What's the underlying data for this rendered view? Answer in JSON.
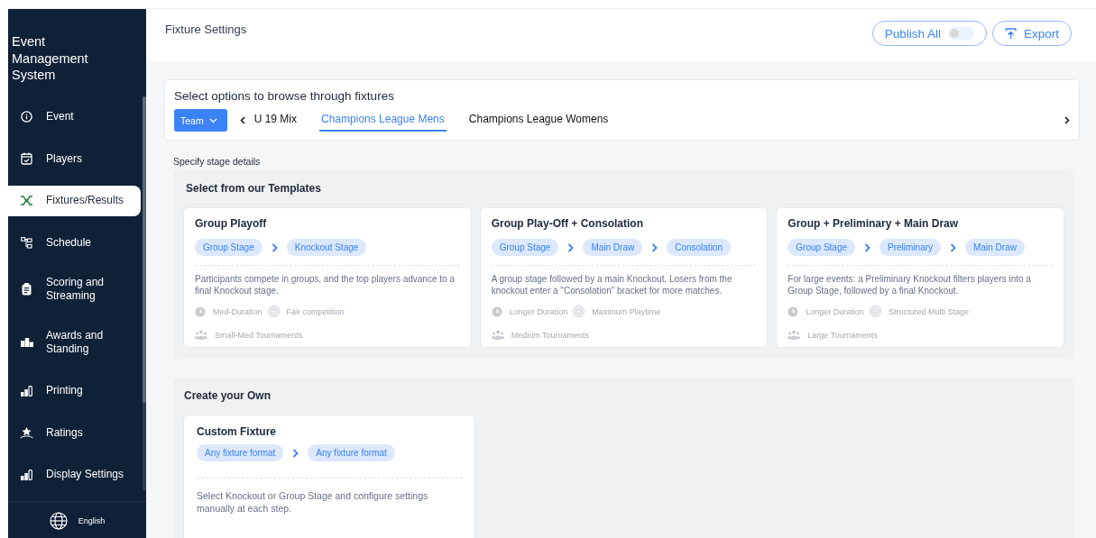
{
  "sidebar": {
    "title": "Event Management System",
    "items": [
      {
        "label": "Event",
        "selected": false
      },
      {
        "label": "Players",
        "selected": false
      },
      {
        "label": "Fixtures/Results",
        "selected": true
      },
      {
        "label": "Schedule",
        "selected": false
      },
      {
        "label": "Scoring and Streaming",
        "selected": false
      },
      {
        "label": "Awards and Standing",
        "selected": false
      },
      {
        "label": "Printing",
        "selected": false
      },
      {
        "label": "Ratings",
        "selected": false
      },
      {
        "label": "Display Settings",
        "selected": false
      }
    ],
    "language": "English"
  },
  "header": {
    "title": "Fixture Settings",
    "publish": {
      "label": "Publish All",
      "on": false
    },
    "export": "Export"
  },
  "browser": {
    "title": "Select options to browse through fixtures",
    "filter": "Team",
    "tabs": [
      {
        "label": "U 19 Mix",
        "selected": false
      },
      {
        "label": "Champions League Mens",
        "selected": true
      },
      {
        "label": "Champions League Womens",
        "selected": false
      }
    ]
  },
  "stage_label": "Specify stage details",
  "templates": {
    "title": "Select from our Templates",
    "cards": [
      {
        "title": "Group Playoff",
        "stages": [
          "Group Stage",
          "Knockout Stage"
        ],
        "description": "Participants compete in groups, and the top players advance to a final Knockout stage.",
        "features": [
          {
            "kind": "duration",
            "label": "Med-Duration"
          },
          {
            "kind": "target",
            "label": "Fair competition"
          },
          {
            "kind": "people",
            "label": "Small-Med Tournaments"
          }
        ]
      },
      {
        "title": "Group Play-Off + Consolation",
        "stages": [
          "Group Stage",
          "Main Draw",
          "Consolation"
        ],
        "description": "A group stage followed by a main Knockout. Losers from the knockout enter a \"Consolation\" bracket for more matches.",
        "features": [
          {
            "kind": "duration",
            "label": "Longer Duration"
          },
          {
            "kind": "target",
            "label": "Maximum Playtime"
          },
          {
            "kind": "people",
            "label": "Medium Tournaments"
          }
        ]
      },
      {
        "title": "Group + Preliminary + Main Draw",
        "stages": [
          "Group Stage",
          "Preliminary",
          "Main Draw"
        ],
        "description": "For large events: a Preliminary Knockout filters players into a Group Stage, followed by a final Knockout.",
        "features": [
          {
            "kind": "duration",
            "label": "Longer Duration"
          },
          {
            "kind": "target",
            "label": "Structured Multi Stage"
          },
          {
            "kind": "people",
            "label": "Large Tournaments"
          }
        ]
      }
    ]
  },
  "custom": {
    "title": "Create your Own",
    "cards": [
      {
        "title": "Custom Fixture",
        "stages": [
          "Any fixture format",
          "Any fixture format"
        ],
        "description": "Select Knockout or Group Stage and configure settings manually at each step."
      }
    ]
  }
}
